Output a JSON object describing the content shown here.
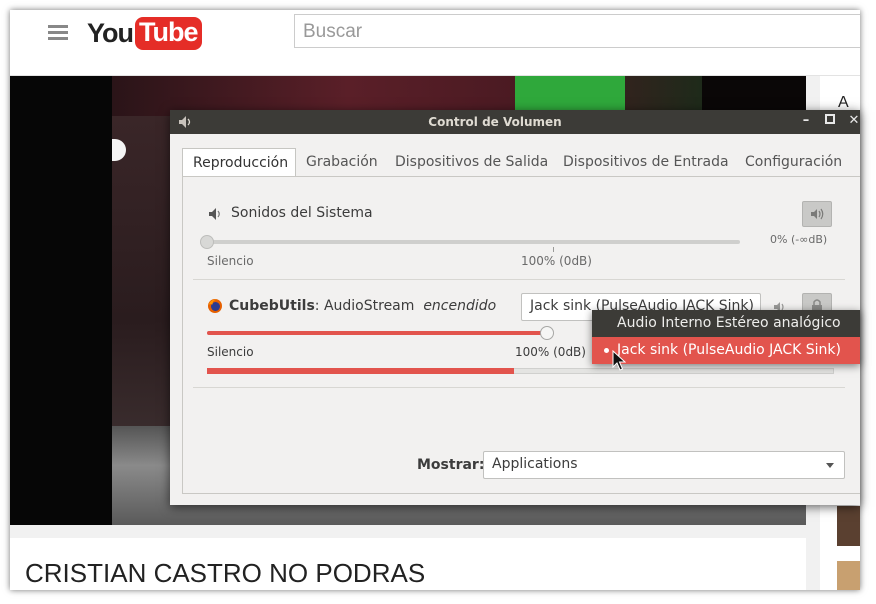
{
  "youtube": {
    "search_placeholder": "Buscar",
    "logo_you": "You",
    "logo_tube": "Tube",
    "sidebar_partial": "A c",
    "video_title": "CRISTIAN CASTRO NO PODRAS"
  },
  "dialog": {
    "title": "Control de Volumen",
    "tabs": [
      "Reproducción",
      "Grabación",
      "Dispositivos de Salida",
      "Dispositivos de Entrada",
      "Configuración"
    ],
    "active_tab": "Reproducción",
    "system_sounds": {
      "label": "Sonidos del Sistema",
      "volume_text": "0% (-∞dB)",
      "volume_fraction": 0.0,
      "silence_label": "Silencio",
      "hundred_label": "100% (0dB)"
    },
    "stream": {
      "app_name": "CubebUtils",
      "separator": ": AudioStream",
      "state": "encendido",
      "device": "Jack sink (PulseAudio JACK Sink)",
      "silence_label": "Silencio",
      "hundred_label": "100% (0dB)",
      "volume_fraction": 1.0,
      "level_fraction": 0.49
    },
    "show_label": "Mostrar:",
    "show_value": "Applications"
  },
  "device_menu": {
    "items": [
      {
        "label": "Audio Interno Estéreo analógico",
        "selected": false
      },
      {
        "label": "Jack sink (PulseAudio JACK Sink)",
        "selected": true
      }
    ]
  },
  "colors": {
    "accent": "#e2544d",
    "titlebar": "#3c3b37",
    "youtube_red": "#e52d27"
  }
}
